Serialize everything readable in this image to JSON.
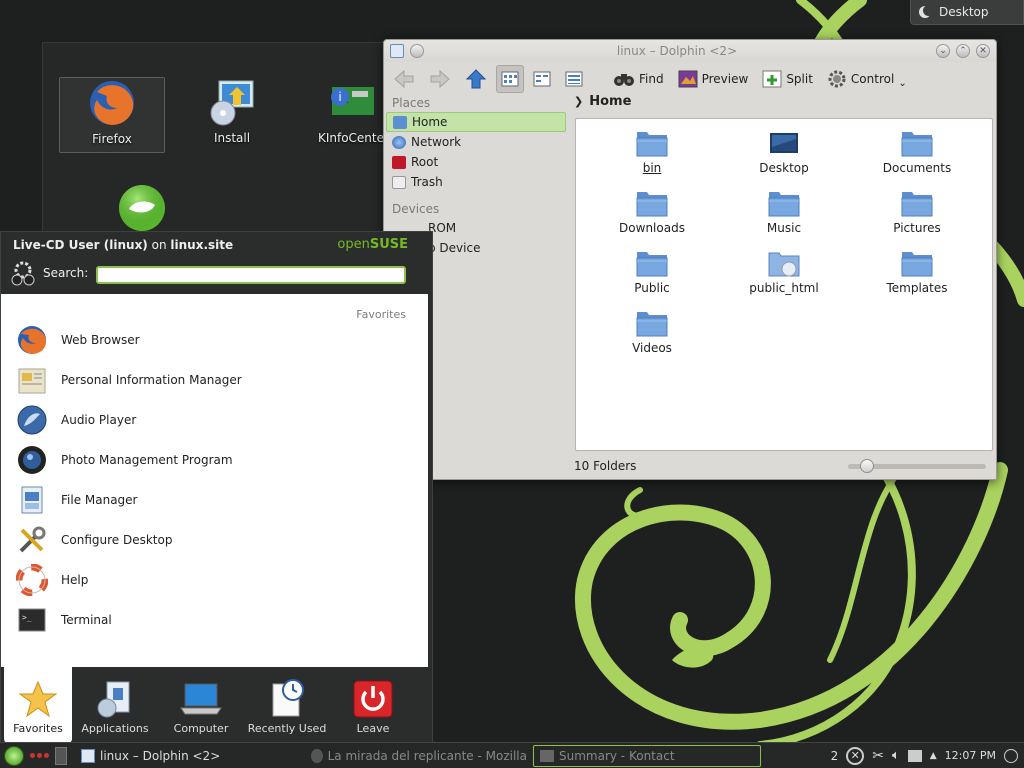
{
  "desktop": {
    "corner_label": "Desktop",
    "icons": [
      {
        "label": "Firefox",
        "icon": "firefox-icon"
      },
      {
        "label": "Install",
        "icon": "install-icon"
      },
      {
        "label": "KInfoCente",
        "icon": "kinfocenter-icon"
      }
    ]
  },
  "dolphin": {
    "title": "linux – Dolphin <2>",
    "toolbar": {
      "find": "Find",
      "preview": "Preview",
      "split": "Split",
      "control": "Control"
    },
    "places_header": "Places",
    "places": [
      "Home",
      "Network",
      "Root",
      "Trash"
    ],
    "devices_header": "Devices",
    "devices": [
      "ROM",
      "p Device"
    ],
    "breadcrumb": "Home",
    "files": [
      "bin",
      "Desktop",
      "Documents",
      "Downloads",
      "Music",
      "Pictures",
      "Public",
      "public_html",
      "Templates",
      "Videos"
    ],
    "status": "10 Folders",
    "zoom_fraction": 0.1
  },
  "kickoff": {
    "user": "Live-CD User (linux)",
    "on": "on",
    "host": "linux.site",
    "brand_open": "open",
    "brand_suse": "SUSE",
    "search_label": "Search:",
    "search_value": "",
    "favorites_header": "Favorites",
    "favorites": [
      "Web Browser",
      "Personal Information Manager",
      "Audio Player",
      "Photo Management Program",
      "File Manager",
      "Configure Desktop",
      "Help",
      "Terminal"
    ],
    "tabs": [
      "Favorites",
      "Applications",
      "Computer",
      "Recently Used",
      "Leave"
    ]
  },
  "taskbar": {
    "tasks": [
      "linux – Dolphin <2>",
      "La mirada del replicante - Mozilla",
      "Summary - Kontact"
    ],
    "desktop_number": "2",
    "clock": "12:07 PM"
  },
  "colors": {
    "suse_green": "#73ba25",
    "highlight": "#8cc04a"
  }
}
